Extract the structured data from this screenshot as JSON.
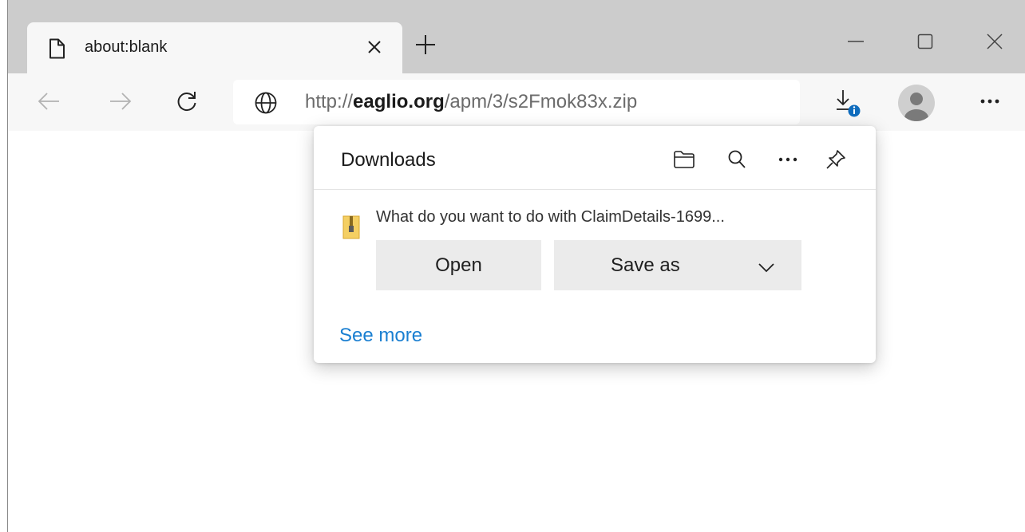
{
  "tab": {
    "title": "about:blank",
    "close_icon": "close-icon",
    "page_icon": "blank-page-icon"
  },
  "new_tab_icon": "plus-icon",
  "window_controls": [
    "minimize-icon",
    "maximize-icon",
    "close-icon"
  ],
  "toolbar": {
    "back_icon": "arrow-left-icon",
    "forward_icon": "arrow-right-icon",
    "refresh_icon": "refresh-icon",
    "downloads_icon": "download-icon",
    "profile_icon": "avatar",
    "menu_icon": "more-horizontal-icon"
  },
  "address": {
    "site_icon": "globe-icon",
    "scheme": "http://",
    "domain": "eaglio.org",
    "path": "/apm/3/s2Fmok83x.zip"
  },
  "downloads_panel": {
    "title": "Downloads",
    "header_icons": [
      "folder-icon",
      "search-icon",
      "more-horizontal-icon",
      "pin-icon"
    ],
    "file_icon": "zip-file-icon",
    "prompt": "What do you want to do with ClaimDetails-1699...",
    "open_label": "Open",
    "save_as_label": "Save as",
    "see_more_label": "See more"
  },
  "colors": {
    "tabstrip": "#cccccc",
    "toolbar": "#f7f7f7",
    "link": "#1a7fd1",
    "button": "#ebebeb",
    "badge": "#0f6cbd"
  }
}
